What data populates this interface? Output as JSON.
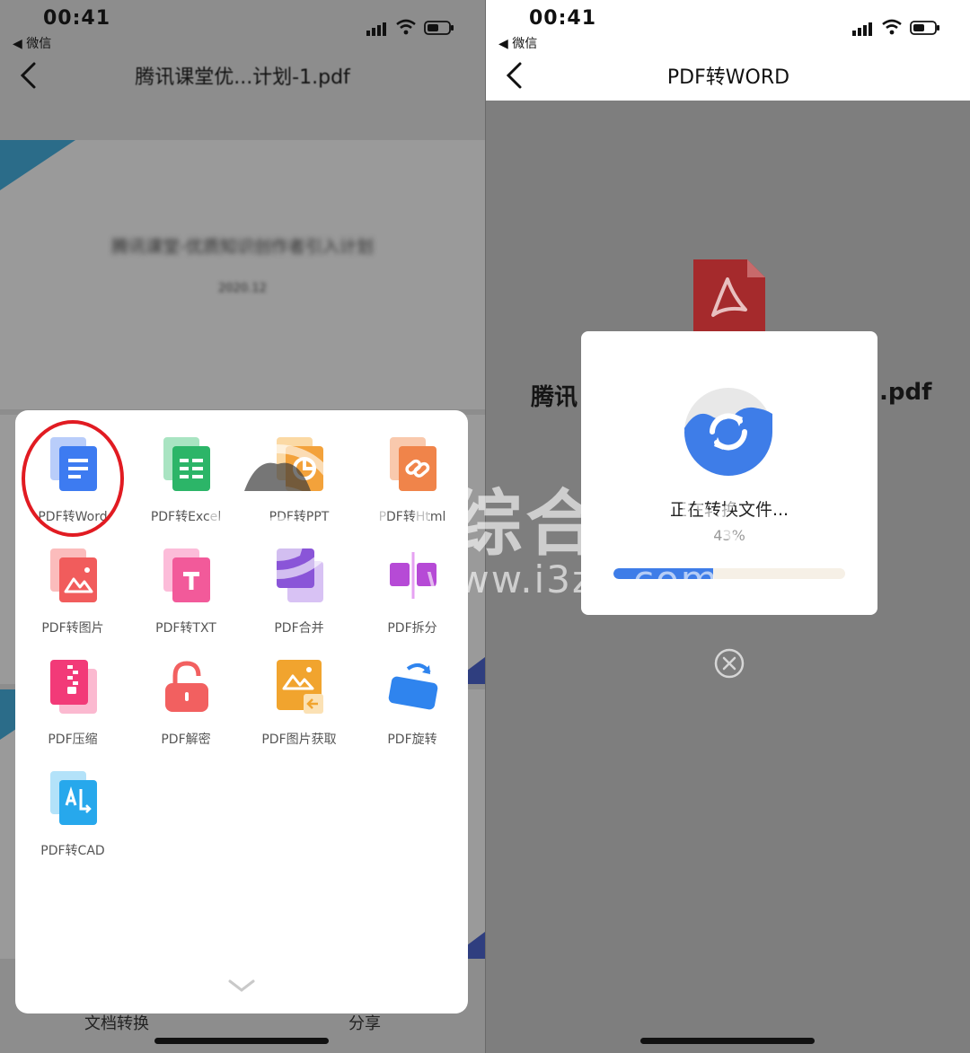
{
  "left": {
    "status": {
      "time": "00:41",
      "back_app": "◀ 微信"
    },
    "nav": {
      "title": "腾讯课堂优...计划-1.pdf"
    },
    "document": {
      "title": "腾讯课堂-优质知识创作者引入计划",
      "date": "2020.12"
    },
    "bottom": {
      "convert_label": "文档转换",
      "share_label": "分享"
    },
    "tools": [
      {
        "label": "PDF转Word",
        "icon": "word-doc-icon",
        "color": "#3d7bf1"
      },
      {
        "label": "PDF转Excel",
        "icon": "excel-sheet-icon",
        "color": "#2cb568"
      },
      {
        "label": "PDF转PPT",
        "icon": "ppt-chart-icon",
        "color": "#f3a23b"
      },
      {
        "label": "PDF转Html",
        "icon": "link-icon",
        "color": "#f0844a"
      },
      {
        "label": "PDF转图片",
        "icon": "image-icon",
        "color": "#f15c5c"
      },
      {
        "label": "PDF转TXT",
        "icon": "text-t-icon",
        "color": "#f25a9a"
      },
      {
        "label": "PDF合并",
        "icon": "merge-icon",
        "color": "#8a55d8"
      },
      {
        "label": "PDF拆分",
        "icon": "split-icon",
        "color": "#b64ad6"
      },
      {
        "label": "PDF压缩",
        "icon": "zip-icon",
        "color": "#f23a78"
      },
      {
        "label": "PDF解密",
        "icon": "unlock-icon",
        "color": "#f26060"
      },
      {
        "label": "PDF图片获取",
        "icon": "image-extract-icon",
        "color": "#f1a42e"
      },
      {
        "label": "PDF旋转",
        "icon": "rotate-icon",
        "color": "#2f84ee"
      },
      {
        "label": "PDF转CAD",
        "icon": "cad-icon",
        "color": "#27a8ec"
      }
    ]
  },
  "right": {
    "status": {
      "time": "00:41",
      "back_app": "◀ 微信"
    },
    "nav": {
      "title": "PDF转WORD"
    },
    "file": {
      "name_start": "腾讯",
      "name_end": ".pdf"
    },
    "dialog": {
      "message": "正在转换文件...",
      "percent_text": "43%",
      "progress": 0.43
    }
  },
  "watermark": {
    "text": "IT综合社区",
    "url": "www.i3zh.com"
  },
  "colors": {
    "accent": "#3e7de8",
    "highlight": "#e11b22",
    "pdf_red": "#b02a2a"
  }
}
